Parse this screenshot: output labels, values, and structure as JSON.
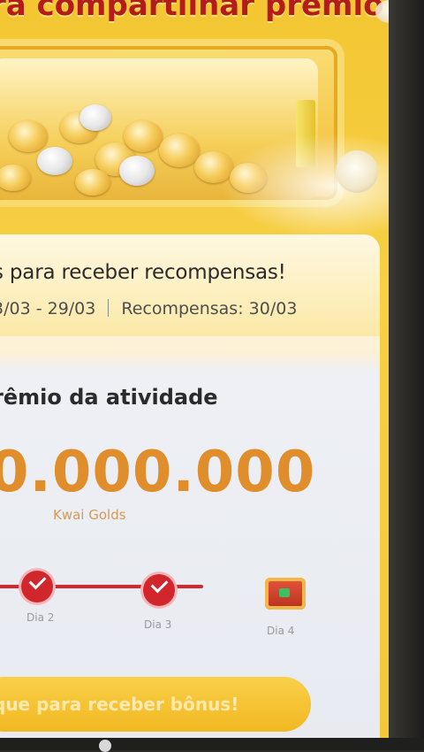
{
  "banner": {
    "title": "ra compartilhar prêmio"
  },
  "card": {
    "headline": "s para receber recompensas!",
    "activity_dates": "3/03 - 29/03",
    "rewards_date": "Recompensas: 30/03",
    "section_title": "rêmio da atividade",
    "prize_amount": "0.000.000",
    "prize_unit": "Kwai Golds",
    "progress": {
      "days": [
        {
          "label": "Dia 2",
          "completed": true
        },
        {
          "label": "Dia 3",
          "completed": true
        },
        {
          "label": "Dia 4",
          "completed": false
        }
      ]
    },
    "cta_label": "que para receber bônus!"
  },
  "colors": {
    "accent": "#e08d2b",
    "progress": "#d2262d",
    "background": "#f3c632"
  },
  "icons": [
    "gold-coin-icon",
    "check-icon",
    "gift-chest-icon"
  ]
}
